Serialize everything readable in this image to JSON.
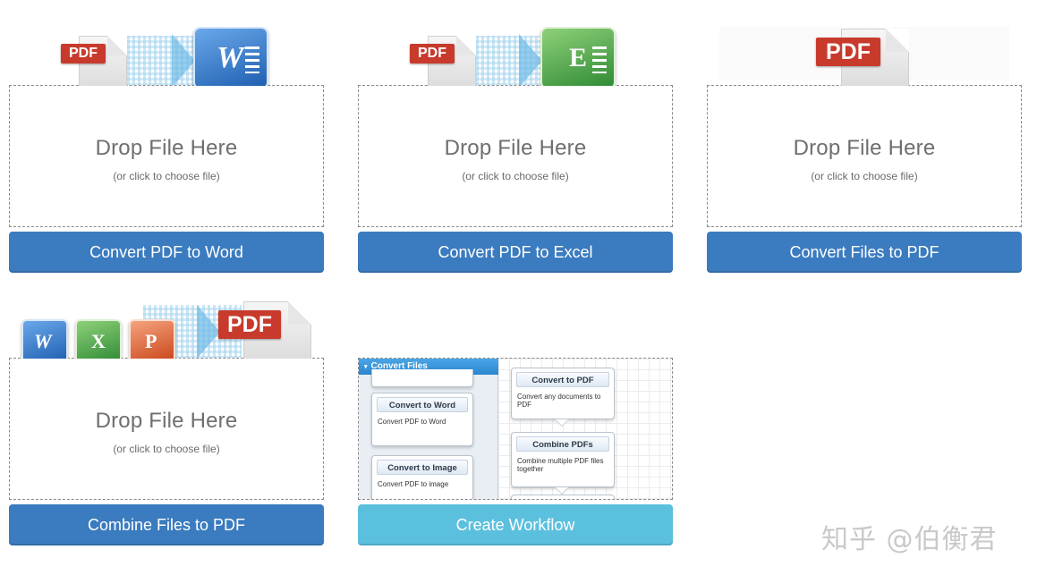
{
  "cards": [
    {
      "id": "pdf-to-word",
      "icon": "pdf-to-word-icon",
      "pdf_badge": "PDF",
      "app_letter": "W",
      "drop_title": "Drop File Here",
      "drop_sub": "(or click to choose file)",
      "button_label": "Convert PDF to Word"
    },
    {
      "id": "pdf-to-excel",
      "icon": "pdf-to-excel-icon",
      "pdf_badge": "PDF",
      "app_letter": "E",
      "drop_title": "Drop File Here",
      "drop_sub": "(or click to choose file)",
      "button_label": "Convert PDF to Excel"
    },
    {
      "id": "files-to-pdf",
      "icon": "pdf-file-icon",
      "pdf_badge": "PDF",
      "drop_title": "Drop File Here",
      "drop_sub": "(or click to choose file)",
      "button_label": "Convert Files to PDF"
    },
    {
      "id": "combine-to-pdf",
      "icon": "office-to-pdf-icon",
      "pdf_badge": "PDF",
      "app_letters": [
        "W",
        "X",
        "P"
      ],
      "drop_title": "Drop File Here",
      "drop_sub": "(or click to choose file)",
      "button_label": "Combine Files to PDF"
    }
  ],
  "workflow": {
    "panel_title": "Convert Files",
    "left_boxes": [
      {
        "title": "Convert to Word",
        "desc": "Convert PDF to Word"
      },
      {
        "title": "Convert to Image",
        "desc": "Convert PDF to image"
      }
    ],
    "right_boxes": [
      {
        "title": "Convert to PDF",
        "desc": "Convert any documents to PDF"
      },
      {
        "title": "Combine PDFs",
        "desc": "Combine multiple PDF files together"
      }
    ],
    "button_label": "Create Workflow"
  },
  "watermark": "知乎 @伯衡君",
  "colors": {
    "primary_button": "#3b7bbf",
    "workflow_button": "#5bc0de",
    "pdf_red": "#c83a2c",
    "word_blue": "#2f6fc0",
    "excel_green": "#3f9e3f",
    "powerpoint_orange": "#d9542a"
  }
}
